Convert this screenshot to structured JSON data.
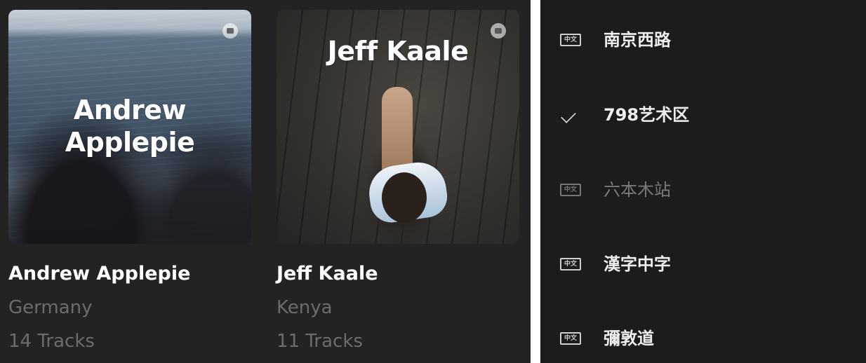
{
  "cards": [
    {
      "cover_title": "Andrew Applepie",
      "name": "Andrew Applepie",
      "country": "Germany",
      "tracks": "14 Tracks"
    },
    {
      "cover_title": "Jeff Kaale",
      "name": "Jeff Kaale",
      "country": "Kenya",
      "tracks": "11 Tracks"
    }
  ],
  "menu": {
    "items": [
      {
        "icon": "中文",
        "label": "南京西路",
        "selected": false,
        "enabled": true
      },
      {
        "icon": "check-icon",
        "label": "798艺术区",
        "selected": true,
        "enabled": true
      },
      {
        "icon": "中文",
        "label": "六本木站",
        "selected": false,
        "enabled": false
      },
      {
        "icon": "中文",
        "label": "漢字中字",
        "selected": false,
        "enabled": true
      },
      {
        "icon": "中文",
        "label": "彌敦道",
        "selected": false,
        "enabled": true
      }
    ]
  },
  "colors": {
    "left_background": "#232323",
    "right_background": "#1c1c1c",
    "primary_text": "#ffffff",
    "secondary_text": "#6c6c6c",
    "disabled_text": "#7a7a7a"
  }
}
